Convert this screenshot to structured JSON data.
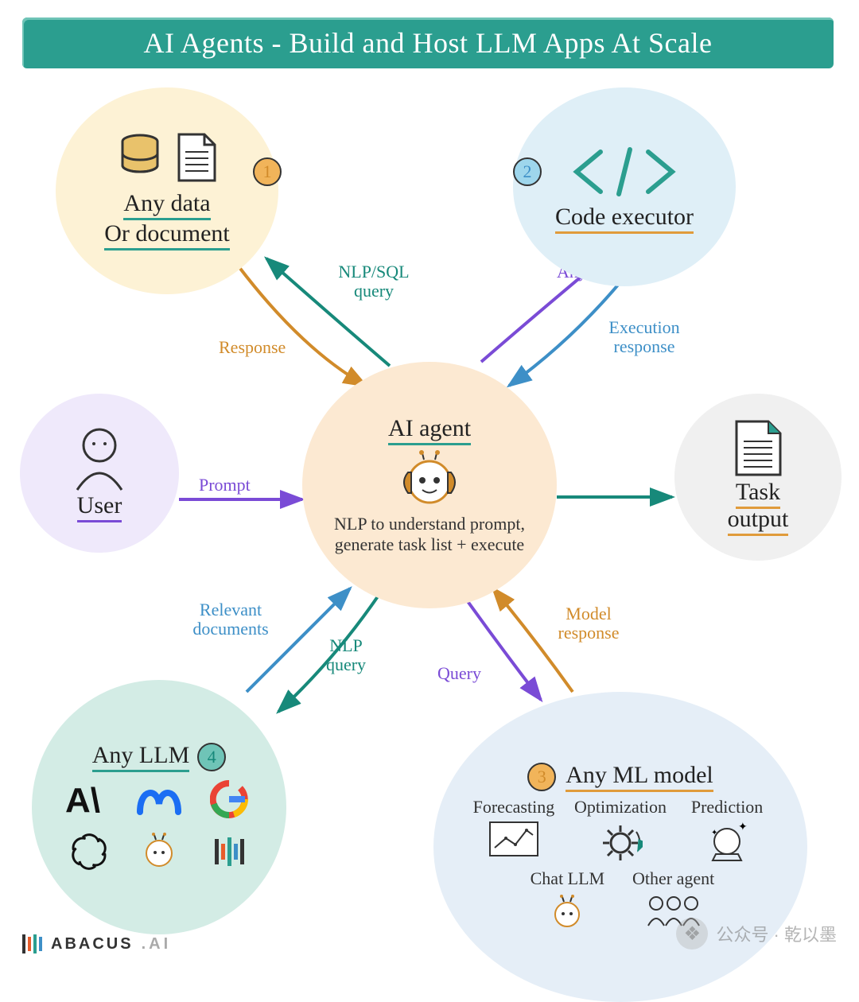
{
  "title": "AI Agents - Build and Host LLM Apps At Scale",
  "nodes": {
    "data": {
      "num": "1",
      "line1": "Any data",
      "line2": "Or document"
    },
    "code": {
      "num": "2",
      "label": "Code executor"
    },
    "agent": {
      "title": "AI agent",
      "desc": "NLP to understand prompt, generate task list + execute"
    },
    "user": {
      "label": "User"
    },
    "task": {
      "line1": "Task",
      "line2": "output"
    },
    "llm": {
      "num": "4",
      "label": "Any LLM",
      "logos": [
        "Anthropic",
        "Meta",
        "Google",
        "OpenAI",
        "Abacus-bot",
        "Mistral"
      ]
    },
    "ml": {
      "num": "3",
      "label": "Any ML model",
      "items": {
        "forecast": "Forecasting",
        "optimize": "Optimization",
        "predict": "Prediction",
        "chatllm": "Chat LLM",
        "other": "Other agent"
      }
    }
  },
  "edges": {
    "data_query": "NLP/SQL query",
    "data_resp": "Response",
    "code_send": "Any code",
    "code_resp": "Execution response",
    "prompt": "Prompt",
    "llm_docs": "Relevant documents",
    "llm_query": "NLP query",
    "ml_query": "Query",
    "ml_resp": "Model response"
  },
  "footer": {
    "brand1": "ABACUS",
    "brand2": ".AI"
  },
  "watermark": {
    "text": "公众号 · 乾以墨"
  }
}
